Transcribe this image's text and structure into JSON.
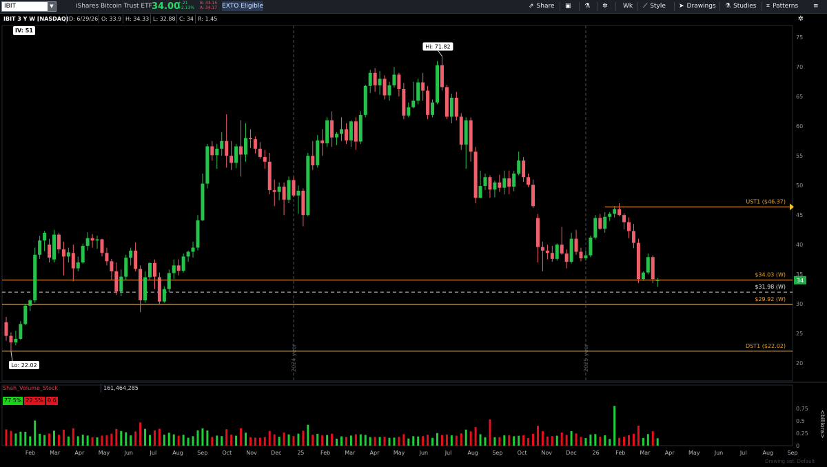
{
  "toolbar": {
    "symbol": "IBIT",
    "name": "iShares Bitcoin Trust ETF",
    "last": "34.00",
    "change": "+.21",
    "change_pct": "+2.13%",
    "bid": "B: 34.15",
    "ask": "A: 34.17",
    "exto": "EXTO Eligible",
    "share": "Share",
    "interval": "Wk",
    "style": "Style",
    "drawings": "Drawings",
    "studies": "Studies",
    "patterns": "Patterns"
  },
  "ohlc": {
    "title": "IBIT 3 Y W [NASDAQ]",
    "date": "D: 6/29/26",
    "open": "O: 33.9",
    "high": "H: 34.33",
    "low": "L: 32.88",
    "close": "C: 34",
    "range": "R: 1.45"
  },
  "iv": "IV: 51",
  "volume": {
    "name": "Shah_Volume_Stock",
    "value": "161,464,285",
    "buy_pct": "77.5%",
    "sell_pct": "22.5%",
    "ratio": "0.6",
    "unit": "<billions>"
  },
  "footer": "Drawing set: Default",
  "colors": {
    "up": "#27c24c",
    "down": "#f0606c",
    "level": "#e8a12a",
    "grid": "#3a3f46"
  },
  "chart_data": [
    {
      "type": "candlestick",
      "ylim": [
        17,
        77
      ],
      "y_ticks": [
        20,
        25,
        30,
        35,
        40,
        45,
        50,
        55,
        60,
        65,
        70,
        75
      ],
      "x_labels": [
        "Feb",
        "Mar",
        "Apr",
        "May",
        "Jun",
        "Jul",
        "Aug",
        "Sep",
        "Oct",
        "Nov",
        "Dec",
        "25",
        "Feb",
        "Mar",
        "Apr",
        "May",
        "Jun",
        "Jul",
        "Aug",
        "Sep",
        "Oct",
        "Nov",
        "Dec",
        "26",
        "Feb",
        "Mar",
        "Apr",
        "May",
        "Jun",
        "Jul",
        "Aug",
        "Sep"
      ],
      "year_markers": [
        "2024 year",
        "2025 year"
      ],
      "hi_label": "Hi: 71.82",
      "lo_label": "Lo: 22.02",
      "last_price_label": "34",
      "levels": [
        {
          "label": "UST1 ($46.37)",
          "value": 46.37
        },
        {
          "label": "$34.03 (W)",
          "value": 34.03
        },
        {
          "label": "$31.98 (W)",
          "value": 31.98,
          "dashed": true
        },
        {
          "label": "$29.92 (W)",
          "value": 29.92
        },
        {
          "label": "DST1 ($22.02)",
          "value": 22.02
        }
      ],
      "candles": [
        [
          26.9,
          27.8,
          23.8,
          24.6
        ],
        [
          24.6,
          25.2,
          22.0,
          23.5
        ],
        [
          23.5,
          25.5,
          23.0,
          24.1
        ],
        [
          24.1,
          27.1,
          23.9,
          26.6
        ],
        [
          26.6,
          29.9,
          26.4,
          29.7
        ],
        [
          29.7,
          30.8,
          28.8,
          30.6
        ],
        [
          30.6,
          39.5,
          30.2,
          38.3
        ],
        [
          38.3,
          41.5,
          37.6,
          40.7
        ],
        [
          40.7,
          42.3,
          38.9,
          42.0
        ],
        [
          40.0,
          41.0,
          37.0,
          37.8
        ],
        [
          37.5,
          42.5,
          37.0,
          41.7
        ],
        [
          41.7,
          42.0,
          38.5,
          39.2
        ],
        [
          39.2,
          40.5,
          34.8,
          38.0
        ],
        [
          38.0,
          39.5,
          37.0,
          38.7
        ],
        [
          38.6,
          40.0,
          33.8,
          36.0
        ],
        [
          36.0,
          38.0,
          35.5,
          37.0
        ],
        [
          37.0,
          40.2,
          36.8,
          39.8
        ],
        [
          39.8,
          42.1,
          39.0,
          41.1
        ],
        [
          41.1,
          41.8,
          39.5,
          40.7
        ],
        [
          40.7,
          41.5,
          39.3,
          40.9
        ],
        [
          40.9,
          41.0,
          38.0,
          38.6
        ],
        [
          38.6,
          39.5,
          36.5,
          37.2
        ],
        [
          37.2,
          37.6,
          34.0,
          35.5
        ],
        [
          35.5,
          37.0,
          31.5,
          32.1
        ],
        [
          32.1,
          35.8,
          31.3,
          34.6
        ],
        [
          34.6,
          38.3,
          34.0,
          37.8
        ],
        [
          37.8,
          39.5,
          36.5,
          39.0
        ],
        [
          39.0,
          40.4,
          35.5,
          35.9
        ],
        [
          35.9,
          36.5,
          28.6,
          30.6
        ],
        [
          30.6,
          35.5,
          30.2,
          34.5
        ],
        [
          34.5,
          37.0,
          34.0,
          36.9
        ],
        [
          36.9,
          37.5,
          32.5,
          34.6
        ],
        [
          34.5,
          35.3,
          30.0,
          30.4
        ],
        [
          30.4,
          33.0,
          30.2,
          32.5
        ],
        [
          32.5,
          35.8,
          32.0,
          35.2
        ],
        [
          35.2,
          37.5,
          34.2,
          36.5
        ],
        [
          36.5,
          37.5,
          34.8,
          35.6
        ],
        [
          35.6,
          38.5,
          35.3,
          38.0
        ],
        [
          38.0,
          39.0,
          37.1,
          38.8
        ],
        [
          38.8,
          40.5,
          37.8,
          39.5
        ],
        [
          39.5,
          45.0,
          39.0,
          44.1
        ],
        [
          44.1,
          52.0,
          44.0,
          50.3
        ],
        [
          50.3,
          57.0,
          49.5,
          56.6
        ],
        [
          56.6,
          57.5,
          54.2,
          55.1
        ],
        [
          55.1,
          57.0,
          52.8,
          56.2
        ],
        [
          56.2,
          59.0,
          55.0,
          57.5
        ],
        [
          57.5,
          62.0,
          53.0,
          55.0
        ],
        [
          55.0,
          57.5,
          52.6,
          53.8
        ],
        [
          53.8,
          57.0,
          52.9,
          56.6
        ],
        [
          56.6,
          61.0,
          51.5,
          55.2
        ],
        [
          55.2,
          60.5,
          54.0,
          58.0
        ],
        [
          58.0,
          59.5,
          56.3,
          57.8
        ],
        [
          57.8,
          58.3,
          55.4,
          56.2
        ],
        [
          56.2,
          57.3,
          54.5,
          54.8
        ],
        [
          54.8,
          56.0,
          52.8,
          54.0
        ],
        [
          54.0,
          55.5,
          48.5,
          49.2
        ],
        [
          49.2,
          51.0,
          46.5,
          48.9
        ],
        [
          48.9,
          50.5,
          47.5,
          49.8
        ],
        [
          49.8,
          50.5,
          45.0,
          47.6
        ],
        [
          47.6,
          51.5,
          47.0,
          50.9
        ],
        [
          50.9,
          51.5,
          48.0,
          48.3
        ],
        [
          48.3,
          50.0,
          45.2,
          49.1
        ],
        [
          49.1,
          49.5,
          43.1,
          45.0
        ],
        [
          45.0,
          55.5,
          44.8,
          55.0
        ],
        [
          55.0,
          57.5,
          52.6,
          53.4
        ],
        [
          53.4,
          58.5,
          53.0,
          57.6
        ],
        [
          57.6,
          59.5,
          55.0,
          57.1
        ],
        [
          57.1,
          61.5,
          56.5,
          61.0
        ],
        [
          61.0,
          62.5,
          56.5,
          58.1
        ],
        [
          58.1,
          59.0,
          56.8,
          58.7
        ],
        [
          58.7,
          61.5,
          57.5,
          59.5
        ],
        [
          59.5,
          60.5,
          57.0,
          57.6
        ],
        [
          57.6,
          61.0,
          56.5,
          60.8
        ],
        [
          60.8,
          61.5,
          56.0,
          57.4
        ],
        [
          57.4,
          62.5,
          57.0,
          61.9
        ],
        [
          61.9,
          67.0,
          61.5,
          66.8
        ],
        [
          66.8,
          69.5,
          65.6,
          69.0
        ],
        [
          69.0,
          69.8,
          65.8,
          66.9
        ],
        [
          66.9,
          69.3,
          65.3,
          68.0
        ],
        [
          68.0,
          68.6,
          64.5,
          65.2
        ],
        [
          65.2,
          67.5,
          64.3,
          66.9
        ],
        [
          66.9,
          70.0,
          66.5,
          68.7
        ],
        [
          68.7,
          69.0,
          65.0,
          66.3
        ],
        [
          66.3,
          67.3,
          61.2,
          61.8
        ],
        [
          61.8,
          64.0,
          61.5,
          63.2
        ],
        [
          63.2,
          67.5,
          63.0,
          64.3
        ],
        [
          64.3,
          68.0,
          63.7,
          67.4
        ],
        [
          67.4,
          69.0,
          64.3,
          66.0
        ],
        [
          66.0,
          66.8,
          61.2,
          61.9
        ],
        [
          61.9,
          64.5,
          61.5,
          64.0
        ],
        [
          64.0,
          71.0,
          63.7,
          70.3
        ],
        [
          70.3,
          71.82,
          66.0,
          66.6
        ],
        [
          66.6,
          67.0,
          61.2,
          61.6
        ],
        [
          61.6,
          65.5,
          60.5,
          64.8
        ],
        [
          64.8,
          65.8,
          61.0,
          61.6
        ],
        [
          61.6,
          62.2,
          56.0,
          56.9
        ],
        [
          56.9,
          61.5,
          52.8,
          61.0
        ],
        [
          61.0,
          61.5,
          54.0,
          55.7
        ],
        [
          55.7,
          56.5,
          47.0,
          47.9
        ],
        [
          47.9,
          52.5,
          47.8,
          49.9
        ],
        [
          49.9,
          52.0,
          49.2,
          51.4
        ],
        [
          51.4,
          51.7,
          47.9,
          49.3
        ],
        [
          49.3,
          50.8,
          48.0,
          50.5
        ],
        [
          50.5,
          51.8,
          48.9,
          49.6
        ],
        [
          49.6,
          52.5,
          48.5,
          51.2
        ],
        [
          51.2,
          52.5,
          48.5,
          49.8
        ],
        [
          49.8,
          52.5,
          49.0,
          52.0
        ],
        [
          52.0,
          55.7,
          51.7,
          54.2
        ],
        [
          54.2,
          54.8,
          50.6,
          51.4
        ],
        [
          51.4,
          52.0,
          49.7,
          50.1
        ],
        [
          50.1,
          51.0,
          46.2,
          46.5
        ],
        [
          44.5,
          45.2,
          37.0,
          39.6
        ],
        [
          39.6,
          40.5,
          35.5,
          39.0
        ],
        [
          39.0,
          40.0,
          37.5,
          38.6
        ],
        [
          38.6,
          39.8,
          37.1,
          37.6
        ],
        [
          37.6,
          40.2,
          37.3,
          40.0
        ],
        [
          40.0,
          43.0,
          38.3,
          38.5
        ],
        [
          38.5,
          39.2,
          36.0,
          37.1
        ],
        [
          37.1,
          42.0,
          36.8,
          41.0
        ],
        [
          41.0,
          42.5,
          38.3,
          38.8
        ],
        [
          38.8,
          39.5,
          37.2,
          37.7
        ],
        [
          37.7,
          39.0,
          37.3,
          38.2
        ],
        [
          38.2,
          41.5,
          37.9,
          41.2
        ],
        [
          41.2,
          45.0,
          40.9,
          44.5
        ],
        [
          44.5,
          45.2,
          42.5,
          42.7
        ],
        [
          42.7,
          45.5,
          42.0,
          44.7
        ],
        [
          44.7,
          45.5,
          44.0,
          45.2
        ],
        [
          45.2,
          46.5,
          44.6,
          46.0
        ],
        [
          46.0,
          47.0,
          44.8,
          45.0
        ],
        [
          45.0,
          45.3,
          42.6,
          43.8
        ],
        [
          43.8,
          44.6,
          41.1,
          42.3
        ],
        [
          42.3,
          43.5,
          39.4,
          40.3
        ],
        [
          40.3,
          41.0,
          33.5,
          34.2
        ],
        [
          34.2,
          35.5,
          33.9,
          35.3
        ],
        [
          35.3,
          38.5,
          35.0,
          37.9
        ],
        [
          37.9,
          38.2,
          33.5,
          34.2
        ],
        [
          33.9,
          34.33,
          32.88,
          34.0
        ]
      ]
    },
    {
      "type": "bar",
      "ylim": [
        0,
        1.0
      ],
      "y_ticks": [
        0,
        0.25,
        0.5,
        0.75
      ]
    }
  ]
}
